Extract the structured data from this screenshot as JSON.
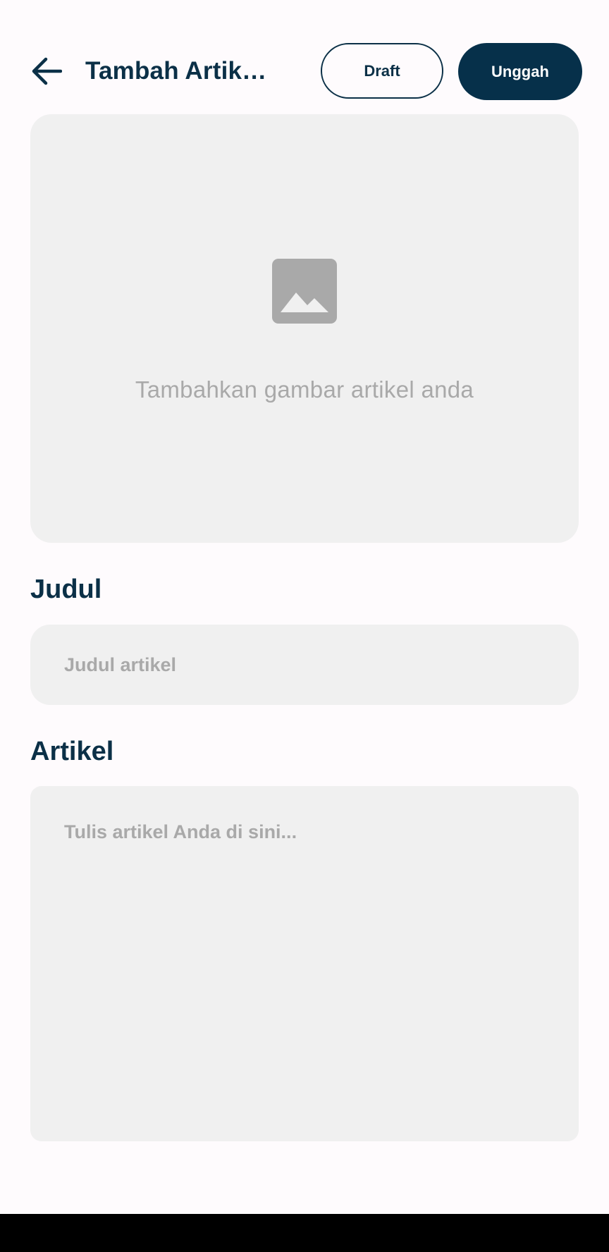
{
  "header": {
    "title": "Tambah Artikel...",
    "draft_label": "Draft",
    "upload_label": "Unggah"
  },
  "image_picker": {
    "icon": "image-icon",
    "hint": "Tambahkan gambar artikel anda"
  },
  "form": {
    "title_label": "Judul",
    "title_placeholder": "Judul artikel",
    "title_value": "",
    "body_label": "Artikel",
    "body_placeholder": "Tulis artikel Anda di sini...",
    "body_value": ""
  },
  "icons": {
    "back": "arrow-back-icon"
  },
  "colors": {
    "primary": "#06304a",
    "field_bg": "#f0f0f0",
    "placeholder": "#a9a9a9",
    "background": "#fefbfd"
  }
}
